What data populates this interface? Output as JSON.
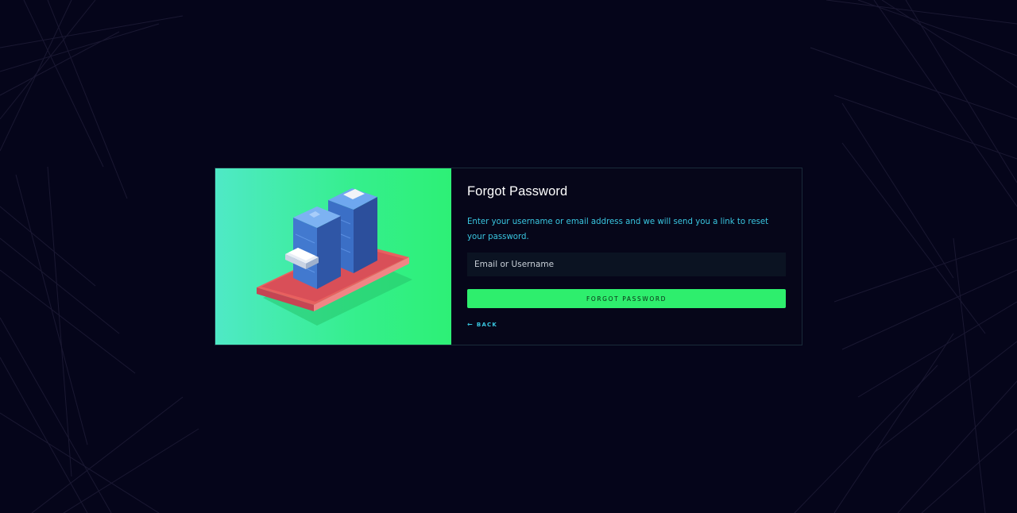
{
  "page": {
    "title": "Forgot Password",
    "description": "Enter your username or email address and we will send you a link to reset your password.",
    "input": {
      "value": "",
      "placeholder": "Email or Username"
    },
    "submit_label": "FORGOT PASSWORD",
    "back_label": "BACK",
    "back_icon": "arrow-left-icon"
  },
  "colors": {
    "background": "#05051a",
    "accent_green": "#2eee6d",
    "accent_cyan": "#39c6e0",
    "input_bg": "#0b1322"
  }
}
